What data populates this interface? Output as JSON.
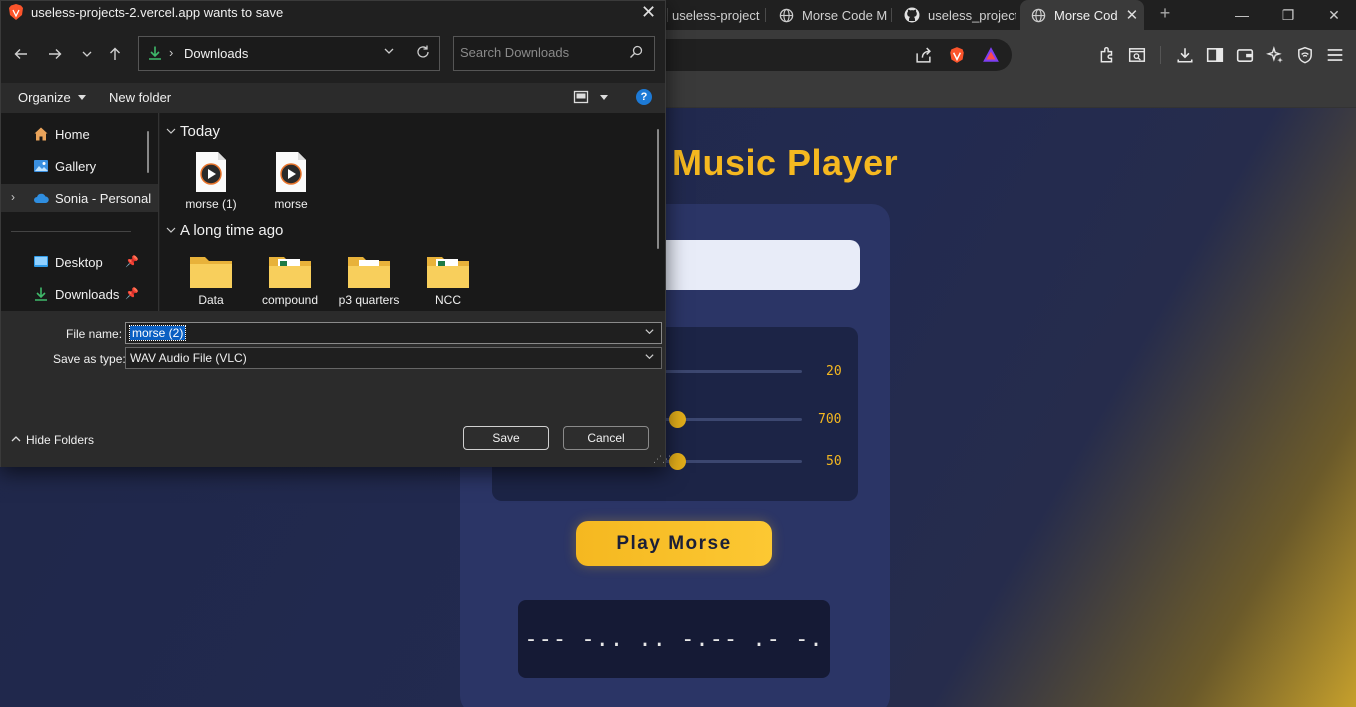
{
  "browser": {
    "tabs": [
      {
        "label": "useless-project",
        "icon": "brave-logo-icon"
      },
      {
        "label": "Morse Code M",
        "icon": "globe-icon"
      },
      {
        "label": "useless_project",
        "icon": "github-icon"
      },
      {
        "label": "Morse Cod",
        "icon": "globe-icon",
        "active": true
      }
    ],
    "new_tab_label": "+",
    "colors": {
      "chrome": "#3a3a3a",
      "tabbar": "#202020"
    }
  },
  "page": {
    "title": "Music Player",
    "sliders": [
      {
        "value": "20"
      },
      {
        "value": "700"
      },
      {
        "value": "50"
      }
    ],
    "play_button": "Play Morse",
    "morse_output": "--- -.. .. -.-- .- -.",
    "colors": {
      "accent": "#f5b820",
      "card": "#2b3566",
      "background": "#222a4f"
    }
  },
  "dialog": {
    "title": "useless-projects-2.vercel.app wants to save",
    "location": "Downloads",
    "search_placeholder": "Search Downloads",
    "toolbar": {
      "organize": "Organize",
      "new_folder": "New folder"
    },
    "nav": [
      {
        "label": "Home",
        "icon": "home-icon"
      },
      {
        "label": "Gallery",
        "icon": "gallery-icon"
      },
      {
        "label": "Sonia - Personal",
        "icon": "onedrive-cloud-icon"
      },
      {
        "label": "Desktop",
        "icon": "desktop-icon"
      },
      {
        "label": "Downloads",
        "icon": "download-icon"
      }
    ],
    "groups": [
      {
        "label": "Today",
        "files": [
          {
            "name": "morse (1)",
            "icon": "audio-file-icon"
          },
          {
            "name": "morse",
            "icon": "audio-file-icon"
          }
        ]
      },
      {
        "label": "A long time ago",
        "files": [
          {
            "name": "Data",
            "icon": "folder-icon"
          },
          {
            "name": "compound",
            "icon": "excel-folder-icon"
          },
          {
            "name": "p3 quarters",
            "icon": "folder-icon"
          },
          {
            "name": "NCC",
            "icon": "excel-folder-icon"
          }
        ]
      }
    ],
    "file_name_label": "File name:",
    "file_name": "morse (2)",
    "save_type_label": "Save as type:",
    "save_type": "WAV Audio File (VLC)",
    "hide_folders": "Hide Folders",
    "save": "Save",
    "cancel": "Cancel",
    "help": "?"
  }
}
